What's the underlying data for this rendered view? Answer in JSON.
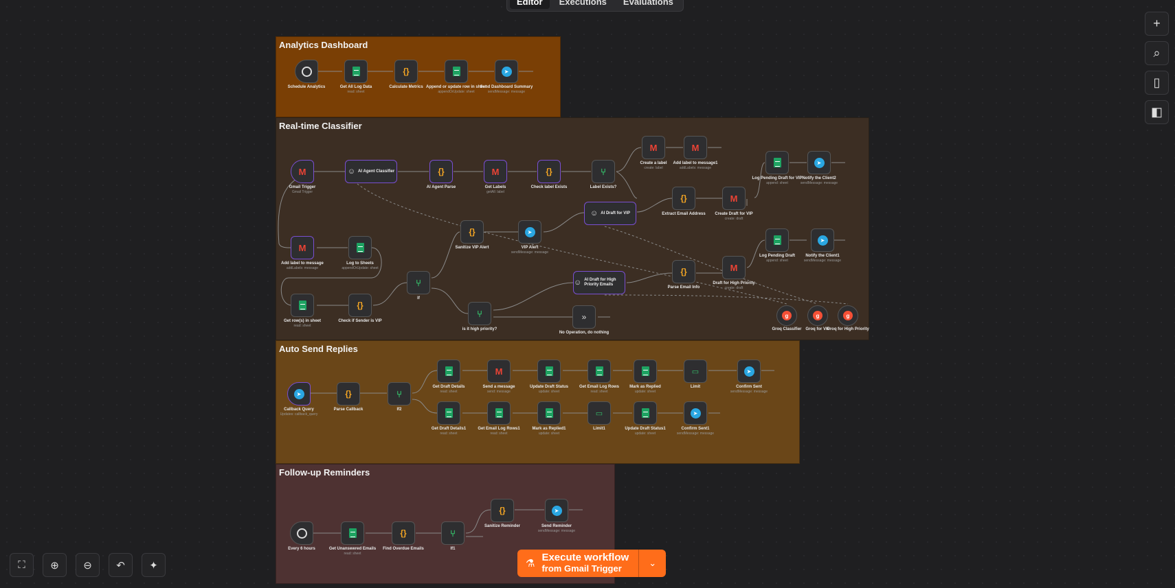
{
  "tabs": [
    {
      "label": "Editor"
    },
    {
      "label": "Executions"
    },
    {
      "label": "Evaluations"
    }
  ],
  "stickies": {
    "analytics": {
      "title": "Analytics Dashboard",
      "color": "#7a3f05"
    },
    "realtime": {
      "title": "Real-time Classifier",
      "color": "#3c2e23"
    },
    "autosend": {
      "title": "Auto Send Replies",
      "color": "#6a4618"
    },
    "followup": {
      "title": "Follow-up Reminders",
      "color": "#4e3232"
    }
  },
  "nodes": {
    "schedule_analytics": {
      "label": "Schedule Analytics",
      "sub": ""
    },
    "get_all_log": {
      "label": "Get All Log Data",
      "sub": "read: sheet"
    },
    "calc_metrics": {
      "label": "Calculate Metrics",
      "sub": ""
    },
    "append_update": {
      "label": "Append or update row in sheet",
      "sub": "appendOrUpdate: sheet"
    },
    "send_dashboard": {
      "label": "Send Dashboard Summary",
      "sub": "sendMessage: message"
    },
    "gmail_trigger": {
      "label": "Gmail Trigger",
      "sub": "Gmail Trigger"
    },
    "ai_classifier": {
      "label": "AI Agent Classifier",
      "sub": ""
    },
    "ai_parse": {
      "label": "AI Agent Parse",
      "sub": ""
    },
    "get_labels": {
      "label": "Get Labels",
      "sub": "getAll: label"
    },
    "check_label": {
      "label": "Check label Exists",
      "sub": ""
    },
    "label_exists": {
      "label": "Label Exists?",
      "sub": ""
    },
    "create_label": {
      "label": "Create a label",
      "sub": "create: label"
    },
    "add_label1": {
      "label": "Add label to message1",
      "sub": "addLabels: message"
    },
    "log_pending_vip": {
      "label": "Log Pending Draft for VIP",
      "sub": "append: sheet"
    },
    "notify_client2": {
      "label": "Notify the Client2",
      "sub": "sendMessage: message"
    },
    "extract_email": {
      "label": "Extract Email Address",
      "sub": ""
    },
    "create_draft_vip": {
      "label": "Create Draft for VIP",
      "sub": "create: draft"
    },
    "ai_draft_vip": {
      "label": "AI Draft for VIP",
      "sub": ""
    },
    "add_label": {
      "label": "Add label to message",
      "sub": "addLabels: message"
    },
    "log_sheets": {
      "label": "Log to Sheets",
      "sub": "appendOrUpdate: sheet"
    },
    "sanitize_vip": {
      "label": "Sanitize VIP Alert",
      "sub": ""
    },
    "vip_alert": {
      "label": "VIP Alert",
      "sub": "sendMessage: message"
    },
    "log_pending": {
      "label": "Log Pending Draft",
      "sub": "append: sheet"
    },
    "notify_client1": {
      "label": "Notify the Client1",
      "sub": "sendMessage: message"
    },
    "if_node": {
      "label": "If",
      "sub": ""
    },
    "ai_draft_high": {
      "label": "AI Draft for High Priority Emails",
      "sub": ""
    },
    "parse_email": {
      "label": "Parse Email Info",
      "sub": ""
    },
    "draft_high": {
      "label": "Draft for High Priority",
      "sub": "create: draft"
    },
    "get_rows": {
      "label": "Get row(s) in sheet",
      "sub": "read: sheet"
    },
    "check_vip": {
      "label": "Check if Sender is VIP",
      "sub": ""
    },
    "is_high": {
      "label": "is it high priority?",
      "sub": ""
    },
    "noop": {
      "label": "No Operation, do nothing",
      "sub": ""
    },
    "groq_classifier": {
      "label": "Groq Classifier",
      "sub": ""
    },
    "groq_vip": {
      "label": "Groq for VIP",
      "sub": ""
    },
    "groq_high": {
      "label": "Groq for High Priority",
      "sub": ""
    },
    "callback_query": {
      "label": "Callback Query",
      "sub": "Updates: callback_query"
    },
    "parse_callback": {
      "label": "Parse Callback",
      "sub": ""
    },
    "if2": {
      "label": "If2",
      "sub": ""
    },
    "get_draft_details": {
      "label": "Get Draft Details",
      "sub": "read: sheet"
    },
    "send_message": {
      "label": "Send a message",
      "sub": "send: message"
    },
    "update_draft_status": {
      "label": "Update Draft Status",
      "sub": "update: sheet"
    },
    "get_email_log": {
      "label": "Get Email Log Rows",
      "sub": "read: sheet"
    },
    "mark_replied": {
      "label": "Mark as Replied",
      "sub": "update: sheet"
    },
    "limit": {
      "label": "Limit",
      "sub": ""
    },
    "confirm_sent": {
      "label": "Confirm Sent",
      "sub": "sendMessage: message"
    },
    "get_draft_details1": {
      "label": "Get Draft Details1",
      "sub": "read: sheet"
    },
    "get_email_log1": {
      "label": "Get Email Log Rows1",
      "sub": "read: sheet"
    },
    "mark_replied1": {
      "label": "Mark as Replied1",
      "sub": "update: sheet"
    },
    "limit1": {
      "label": "Limit1",
      "sub": ""
    },
    "update_draft_status1": {
      "label": "Update Draft Status1",
      "sub": "update: sheet"
    },
    "confirm_sent1": {
      "label": "Confirm Sent1",
      "sub": "sendMessage: message"
    },
    "every6": {
      "label": "Every 6 hours",
      "sub": ""
    },
    "get_unanswered": {
      "label": "Get Unanswered Emails",
      "sub": "read: sheet"
    },
    "find_overdue": {
      "label": "Find Overdue Emails",
      "sub": ""
    },
    "if1": {
      "label": "If1",
      "sub": ""
    },
    "sanitize_reminder": {
      "label": "Sanitize Reminder",
      "sub": ""
    },
    "send_reminder": {
      "label": "Send Reminder",
      "sub": "sendMessage: message"
    }
  },
  "agent_labels": {
    "ai_classifier": "AI Agent Classifier",
    "ai_draft_vip": "AI Draft for VIP",
    "ai_draft_high": "AI Draft for High Priority Emails"
  },
  "execute": {
    "line1": "Execute workflow",
    "line2": "from Gmail Trigger"
  },
  "icons": {
    "plus": "plus-icon",
    "search": "search-icon",
    "sticky": "sticky-note-icon",
    "panel": "panel-icon",
    "fit": "fit-view-icon",
    "zoom_in": "zoom-in-icon",
    "zoom_out": "zoom-out-icon",
    "undo": "undo-icon",
    "tidy": "tidy-up-icon"
  }
}
